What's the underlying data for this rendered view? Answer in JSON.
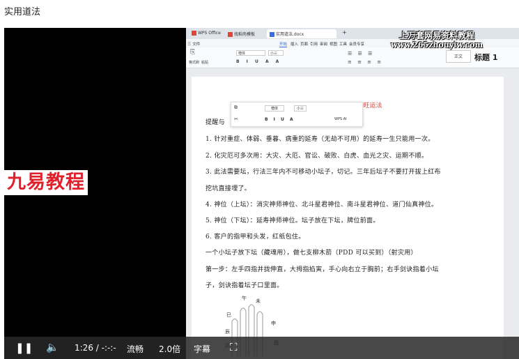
{
  "page": {
    "title": "实用道法"
  },
  "watermarks": {
    "left": "九易教程",
    "right_line1": "上万套网易资料教程",
    "right_line2": "www.265zhouyiw.com"
  },
  "app": {
    "tabs": [
      {
        "label": "WPS Office",
        "color": "#e0453a"
      },
      {
        "label": "找稻壳模板",
        "color": "#e0453a"
      },
      {
        "label": "实用道法.docx",
        "color": "#3a6ee0"
      }
    ],
    "tab_add": "+",
    "menu": [
      "三 文件",
      "开始",
      "插入",
      "页面",
      "引用",
      "审阅",
      "视图",
      "工具",
      "会员专享"
    ],
    "ribbon": {
      "paste_label": "格式刷",
      "clipboard_label": "粘贴",
      "font_name": "楷体",
      "font_size": "小三",
      "style_box": "正文",
      "heading_label": "标题 1"
    }
  },
  "document": {
    "title": "茅山北斗延寿化灾旺运法",
    "lines": [
      "提醒与",
      "1. 针对重症、体弱、垂暮、病重的延寿（无劫不可用）的延寿一生只能用一次。",
      "2. 化灾厄可多次用：大灾、大厄、官讼、破败、白虎、血光之灾、运期不顺。",
      "3. 此法需要坛，行法三年内不可移动小坛子，切记。三年后坛子不要打开拔上红布",
      "挖坑直接埋了。",
      "4. 神位（上坛）：消灾神师神位、北斗星君神位、南斗星君神位、道门仙真神位。",
      "5. 神位（下坛）：延寿神师神位。坛子放在下坛，牌位前面。",
      "6. 客户的指甲和头发，红纸包住。",
      "一个小坛子放下坛（藏魂用），做七支柳木箭（PDD 可以买到）（射灾用）",
      "第一步：左手四指并拢伸直，大拇指掐寅，手心向右立于胸前；右手剑诀指着小坛",
      "子，剑诀指着坛子口里面。"
    ],
    "floatbar": {
      "font_name": "楷体",
      "font_size": "小三",
      "extra": "WPS AI"
    }
  },
  "diagram": {
    "labels": [
      "午",
      "巳",
      "未",
      "辰",
      "申",
      "卯",
      "酉"
    ]
  },
  "controls": {
    "time": "1:26 / -:-:-",
    "quality": "流畅",
    "speed": "2.0倍",
    "subtitle": "字幕"
  }
}
